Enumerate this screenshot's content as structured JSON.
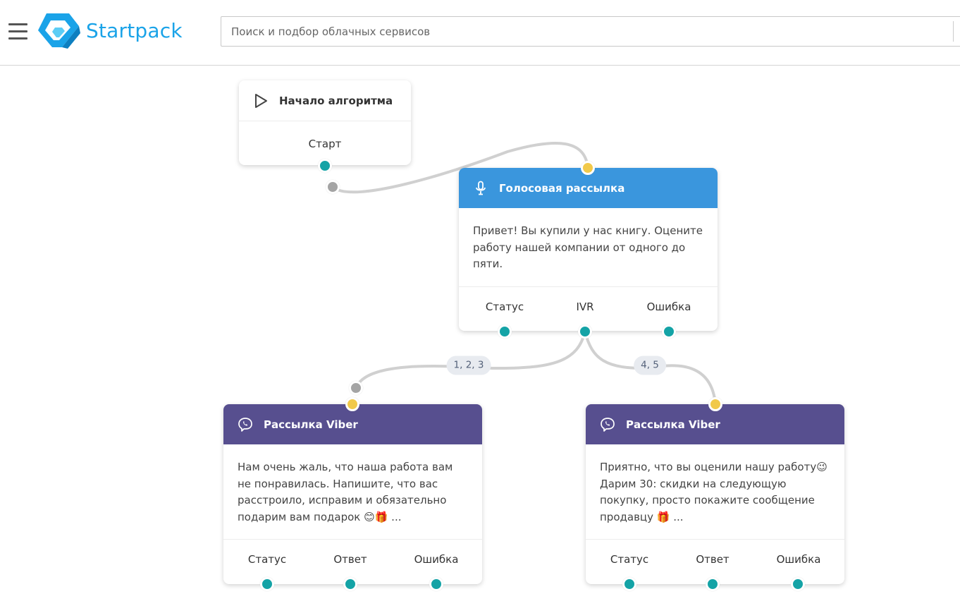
{
  "header": {
    "logo_text": "Startpack",
    "search_placeholder": "Поиск и подбор облачных сервисов"
  },
  "colors": {
    "brand": "#1aa3e8",
    "voice_header": "#3a96dd",
    "viber_header": "#574f8f",
    "port_teal": "#14a3a6",
    "port_yellow": "#f1c94a",
    "port_gray": "#a4a4a4"
  },
  "nodes": {
    "start": {
      "title": "Начало алгоритма",
      "icon": "play-icon",
      "output_label": "Старт"
    },
    "voice": {
      "title": "Голосовая рассылка",
      "icon": "microphone-icon",
      "message": "Привет! Вы купили у нас книгу. Оцените работу нашей компании от одного до пяти.",
      "ports": [
        "Статус",
        "IVR",
        "Ошибка"
      ]
    },
    "viber_left": {
      "title": "Рассылка Viber",
      "icon": "viber-icon",
      "message": "Нам очень жаль, что наша работа вам не понравилась. Напишите, что вас расстроило, исправим и обязательно подарим вам подарок 😊🎁 ...",
      "ports": [
        "Статус",
        "Ответ",
        "Ошибка"
      ]
    },
    "viber_right": {
      "title": "Рассылка Viber",
      "icon": "viber-icon",
      "message": "Приятно, что вы оценили нашу работу😉 Дарим 30: скидки на следующую покупку, просто покажите сообщение продавцу 🎁 ...",
      "ports": [
        "Статус",
        "Ответ",
        "Ошибка"
      ]
    }
  },
  "connections": {
    "left_condition": "1, 2, 3",
    "right_condition": "4, 5"
  }
}
